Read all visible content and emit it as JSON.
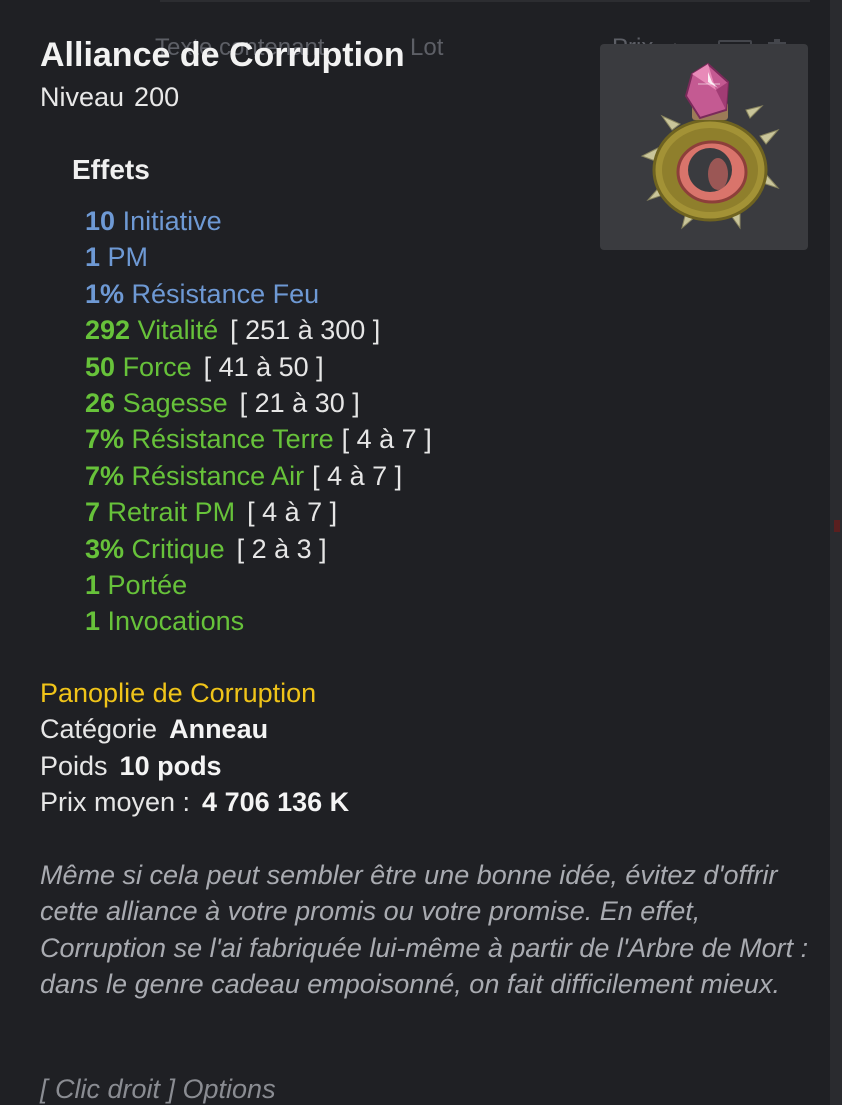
{
  "background": {
    "columns": {
      "text": "Texte contenant",
      "lot": "Lot",
      "price": "Prix"
    }
  },
  "item": {
    "name": "Alliance de Corruption",
    "level_label": "Niveau",
    "level_value": "200",
    "image_icon": "ring-icon",
    "effects_heading": "Effets",
    "effects": [
      {
        "value": "10",
        "stat": "Initiative",
        "range": "",
        "color": "blue"
      },
      {
        "value": "1",
        "stat": "PM",
        "range": "",
        "color": "blue"
      },
      {
        "value": "1%",
        "stat": "Résistance Feu",
        "range": "",
        "color": "blue"
      },
      {
        "value": "292",
        "stat": "Vitalité",
        "range": "[ 251 à 300 ]",
        "color": "green"
      },
      {
        "value": "50",
        "stat": "Force",
        "range": "[ 41 à 50 ]",
        "color": "green"
      },
      {
        "value": "26",
        "stat": "Sagesse",
        "range": "[ 21 à 30 ]",
        "color": "green"
      },
      {
        "value": "7%",
        "stat": "Résistance Terre",
        "range": "[ 4 à 7 ]",
        "color": "green"
      },
      {
        "value": "7%",
        "stat": "Résistance Air",
        "range": "[ 4 à 7 ]",
        "color": "green"
      },
      {
        "value": "7",
        "stat": "Retrait PM",
        "range": "[ 4 à 7 ]",
        "color": "green"
      },
      {
        "value": "3%",
        "stat": "Critique",
        "range": "[ 2 à 3 ]",
        "color": "green"
      },
      {
        "value": "1",
        "stat": "Portée",
        "range": "",
        "color": "green"
      },
      {
        "value": "1",
        "stat": "Invocations",
        "range": "",
        "color": "green"
      }
    ],
    "set_name": "Panoplie de Corruption",
    "category_label": "Catégorie",
    "category_value": "Anneau",
    "weight_label": "Poids",
    "weight_value": "10 pods",
    "avg_price_label": "Prix moyen :",
    "avg_price_value": "4 706 136 K",
    "description": "Même si cela peut sembler être une bonne idée, évitez d'offrir cette alliance à votre promis ou votre promise. En effet, Corruption se l'ai fabriquée lui-même à partir de l'Arbre de Mort : dans le genre cadeau empoisonné, on fait difficilement mieux.",
    "options_hint": "[ Clic droit ] Options"
  },
  "colors": {
    "background": "#1f2024",
    "effect_blue": "#6e99d4",
    "effect_green": "#67c23a",
    "set_gold": "#f0c419",
    "description_gray": "#a9abb1"
  }
}
